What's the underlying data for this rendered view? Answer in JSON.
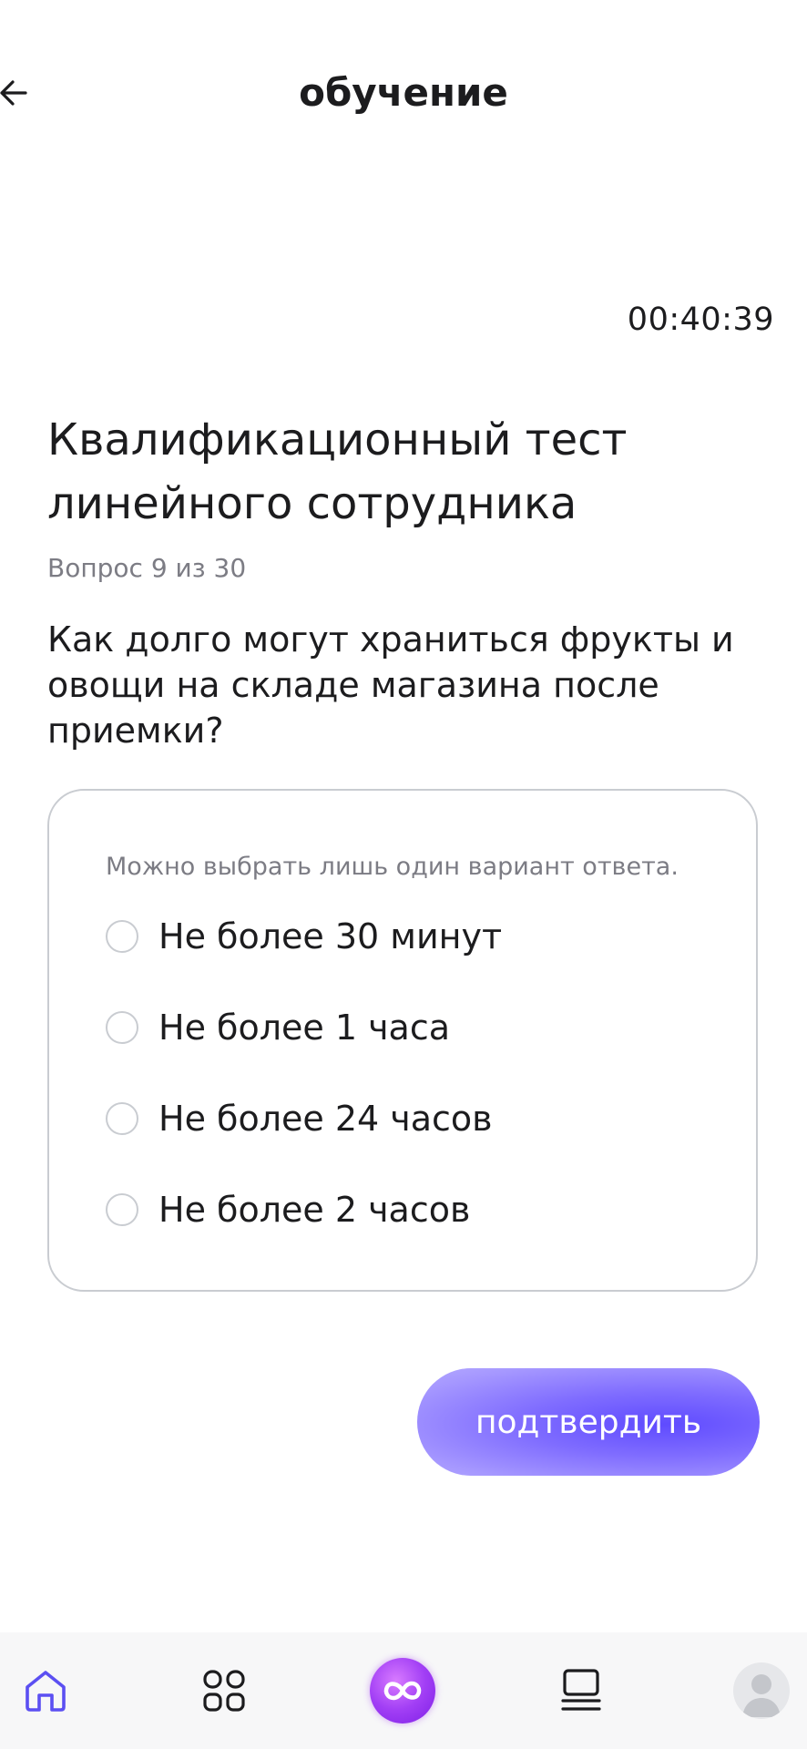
{
  "header": {
    "title": "обучение"
  },
  "timer": "00:40:39",
  "test": {
    "title": "Квалификационный тест линейного сотрудника",
    "counter": "Вопрос 9 из 30",
    "question": "Как долго могут храниться фрукты и овощи на складе магазина после приемки?"
  },
  "answers": {
    "hint": "Можно выбрать лишь один вариант ответа.",
    "options": [
      {
        "label": "Не более 30 минут"
      },
      {
        "label": "Не более 1 часа"
      },
      {
        "label": "Не более 24 часов"
      },
      {
        "label": "Не более 2 часов"
      }
    ]
  },
  "confirm_label": "подтвердить",
  "colors": {
    "accent": "#6a55ff",
    "text": "#1c1c1e",
    "muted": "#7c7c84",
    "border": "#c9ccd1",
    "tab_active": "#5b4ff2"
  },
  "tabbar": {
    "items": [
      {
        "icon": "home-icon"
      },
      {
        "icon": "grid-icon"
      },
      {
        "icon": "infinity-icon"
      },
      {
        "icon": "list-icon"
      },
      {
        "icon": "avatar-icon"
      }
    ]
  }
}
